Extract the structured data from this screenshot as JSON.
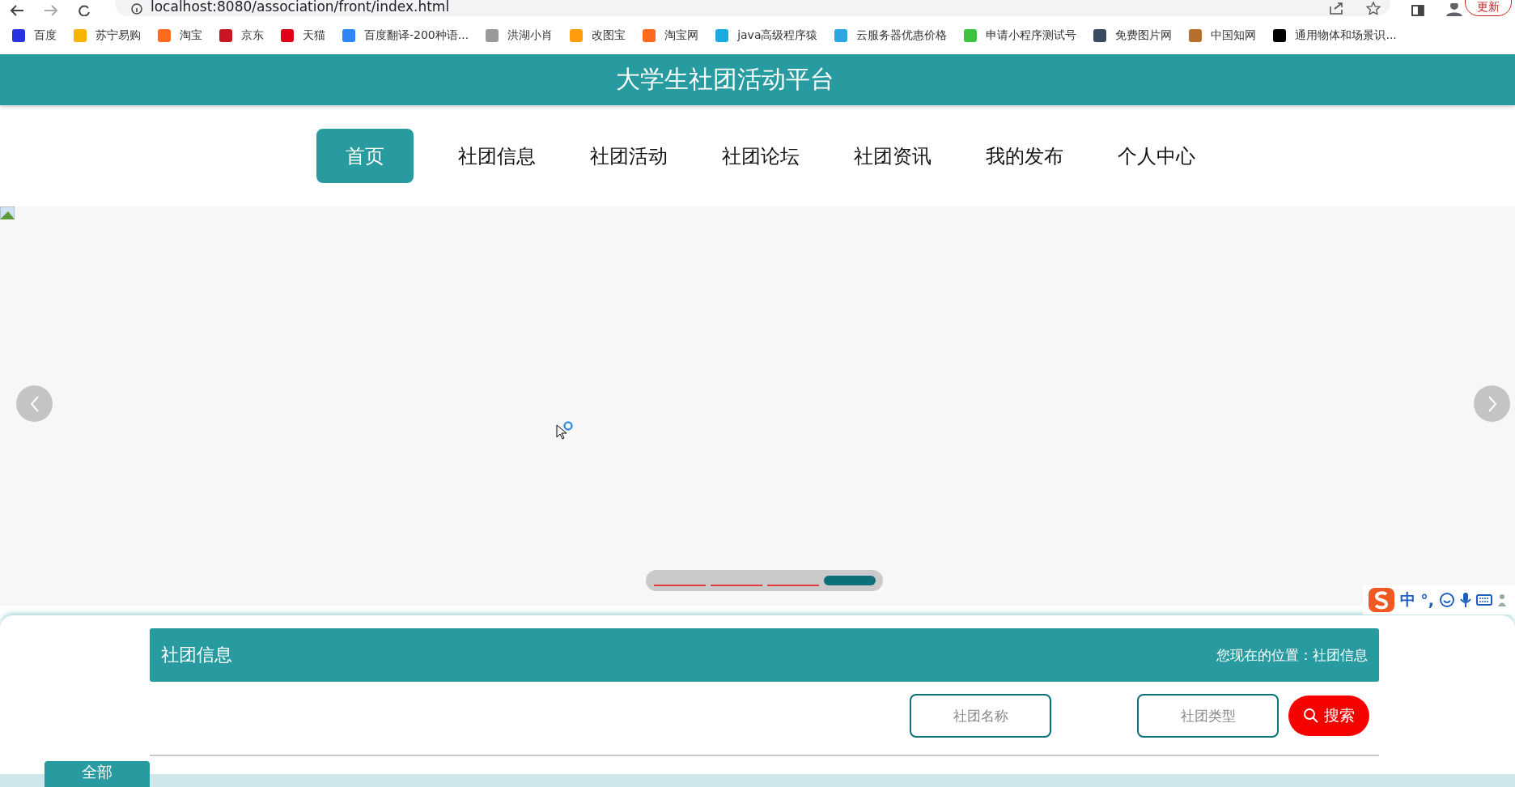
{
  "browser": {
    "address": "localhost:8080/association/front/index.html",
    "update_button": "更新",
    "bookmarks": [
      {
        "label": "百度",
        "color": "#2932e1"
      },
      {
        "label": "苏宁易购",
        "color": "#f5b400"
      },
      {
        "label": "淘宝",
        "color": "#ff6a1f"
      },
      {
        "label": "京东",
        "color": "#c81623"
      },
      {
        "label": "天猫",
        "color": "#e1001a"
      },
      {
        "label": "百度翻译-200种语...",
        "color": "#2f86f6"
      },
      {
        "label": "洪湖小肖",
        "color": "#9a9a9a"
      },
      {
        "label": "改图宝",
        "color": "#ff9d0b"
      },
      {
        "label": "淘宝网",
        "color": "#ff6a1f"
      },
      {
        "label": "java高级程序猿",
        "color": "#1ba9e1"
      },
      {
        "label": "云服务器优惠价格",
        "color": "#2aa6e0"
      },
      {
        "label": "申请小程序测试号",
        "color": "#3ec33e"
      },
      {
        "label": "免费图片网",
        "color": "#3a4a63"
      },
      {
        "label": "中国知网",
        "color": "#b5702c"
      },
      {
        "label": "通用物体和场景识...",
        "color": "#000000"
      }
    ]
  },
  "header": {
    "title": "大学生社团活动平台"
  },
  "nav": [
    {
      "label": "首页",
      "selected": true
    },
    {
      "label": "社团信息",
      "selected": false
    },
    {
      "label": "社团活动",
      "selected": false
    },
    {
      "label": "社团论坛",
      "selected": false
    },
    {
      "label": "社团资讯",
      "selected": false
    },
    {
      "label": "我的发布",
      "selected": false
    },
    {
      "label": "个人中心",
      "selected": false
    }
  ],
  "carousel": {
    "indicators": [
      {
        "selected": false
      },
      {
        "selected": false
      },
      {
        "selected": false
      },
      {
        "selected": true
      }
    ]
  },
  "ime_toolbar": {
    "mode": "中",
    "punctuation": "°,"
  },
  "section": {
    "title": "社团信息",
    "breadcrumb": "您现在的位置：社团信息",
    "filters": [
      {
        "placeholder": "社团名称"
      },
      {
        "placeholder": "社团类型"
      }
    ],
    "search_button": "搜索",
    "tab": "全部"
  }
}
